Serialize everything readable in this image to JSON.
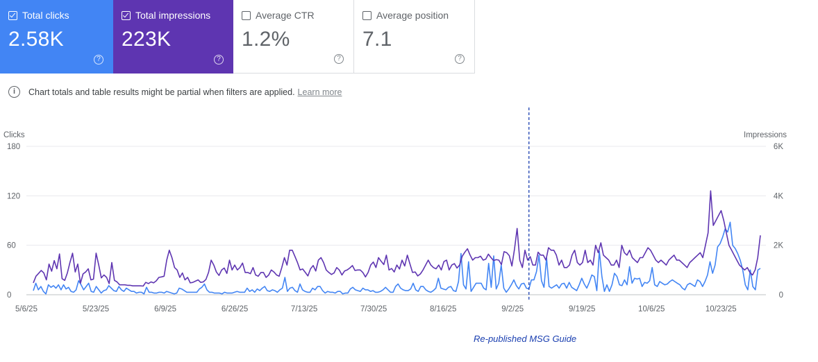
{
  "cards": [
    {
      "label": "Total clicks",
      "value": "2.58K",
      "checked": true
    },
    {
      "label": "Total impressions",
      "value": "223K",
      "checked": true
    },
    {
      "label": "Average CTR",
      "value": "1.2%",
      "checked": false
    },
    {
      "label": "Average position",
      "value": "7.1",
      "checked": false
    }
  ],
  "notice": {
    "text": "Chart totals and table results might be partial when filters are applied.",
    "link": "Learn more"
  },
  "help_glyph": "?",
  "info_glyph": "i",
  "footer": "Re-published MSG Guide",
  "colors": {
    "clicks": "#4285f4",
    "impressions": "#5e35b1",
    "annotation": "#1a3fb0"
  },
  "chart_data": {
    "type": "line",
    "ylabel_left": "Clicks",
    "ylabel_right": "Impressions",
    "ylim_left": [
      0,
      180
    ],
    "ylim_right": [
      0,
      6000
    ],
    "yticks_left": [
      "0",
      "60",
      "120",
      "180"
    ],
    "yticks_right": [
      "0",
      "2K",
      "4K",
      "6K"
    ],
    "x_start": "5/6/25",
    "x_end": "11/3/25",
    "xticks": [
      "5/6/25",
      "5/23/25",
      "6/9/25",
      "6/26/25",
      "7/13/25",
      "7/30/25",
      "8/16/25",
      "9/2/25",
      "9/19/25",
      "10/6/25",
      "10/23/25"
    ],
    "annotation_date": "9/6/25",
    "grid": true,
    "series": [
      {
        "name": "Clicks",
        "axis": "left",
        "values": [
          5,
          14,
          6,
          10,
          4,
          1,
          12,
          9,
          11,
          8,
          12,
          6,
          12,
          7,
          9,
          4,
          3,
          6,
          17,
          12,
          6,
          10,
          14,
          4,
          3,
          10,
          6,
          2,
          5,
          6,
          11,
          8,
          5,
          4,
          10,
          6,
          4,
          8,
          6,
          4,
          4,
          2,
          3,
          3,
          1,
          9,
          3,
          3,
          2,
          2,
          3,
          3,
          2,
          4,
          3,
          2,
          1,
          2,
          8,
          7,
          5,
          3,
          3,
          3,
          3,
          3,
          7,
          9,
          13,
          6,
          3,
          3,
          2,
          2,
          2,
          1,
          3,
          2,
          2,
          2,
          3,
          4,
          3,
          3,
          3,
          8,
          4,
          6,
          3,
          7,
          5,
          8,
          10,
          5,
          4,
          6,
          5,
          3,
          6,
          8,
          21,
          4,
          8,
          9,
          5,
          3,
          13,
          6,
          4,
          3,
          3,
          8,
          6,
          10,
          10,
          5,
          2,
          4,
          3,
          3,
          2,
          4,
          4,
          1,
          2,
          2,
          7,
          9,
          6,
          5,
          4,
          8,
          6,
          6,
          4,
          5,
          3,
          3,
          4,
          6,
          9,
          6,
          3,
          3,
          10,
          13,
          8,
          6,
          5,
          5,
          7,
          14,
          6,
          4,
          10,
          10,
          6,
          4,
          3,
          5,
          8,
          20,
          8,
          7,
          6,
          9,
          10,
          5,
          4,
          16,
          50,
          12,
          7,
          40,
          4,
          9,
          14,
          14,
          14,
          8,
          6,
          38,
          9,
          47,
          7,
          14,
          36,
          8,
          3,
          7,
          12,
          18,
          11,
          7,
          13,
          14,
          8,
          7,
          18,
          18,
          28,
          48,
          17,
          9,
          45,
          10,
          8,
          10,
          12,
          8,
          13,
          14,
          8,
          15,
          9,
          7,
          5,
          12,
          20,
          13,
          8,
          15,
          24,
          22,
          5,
          53,
          22,
          4,
          12,
          4,
          12,
          26,
          22,
          12,
          11,
          18,
          12,
          34,
          14,
          20,
          19,
          20,
          10,
          15,
          14,
          17,
          33,
          12,
          10,
          16,
          14,
          12,
          13,
          16,
          18,
          16,
          14,
          12,
          8,
          6,
          12,
          14,
          12,
          10,
          18,
          16,
          10,
          16,
          24,
          40,
          26,
          36,
          58,
          62,
          70,
          80,
          76,
          88,
          60,
          56,
          50,
          42,
          30,
          12,
          6,
          30,
          10,
          6,
          30,
          32
        ]
      },
      {
        "name": "Total impressions",
        "axis": "right",
        "values": [
          480,
          750,
          860,
          980,
          880,
          600,
          1240,
          950,
          1380,
          1050,
          1650,
          650,
          580,
          880,
          1300,
          1680,
          920,
          1240,
          460,
          840,
          920,
          1050,
          600,
          630,
          1680,
          1200,
          680,
          800,
          700,
          450,
          1300,
          580,
          520,
          400,
          400,
          400,
          380,
          380,
          360,
          360,
          360,
          360,
          350,
          500,
          450,
          520,
          480,
          560,
          700,
          720,
          750,
          1400,
          1800,
          1500,
          1100,
          1000,
          700,
          880,
          600,
          700,
          480,
          500,
          550,
          600,
          500,
          520,
          620,
          900,
          1400,
          1200,
          920,
          780,
          1000,
          1080,
          860,
          1400,
          1000,
          1200,
          1000,
          1100,
          1280,
          900,
          900,
          850,
          1100,
          800,
          750,
          900,
          900,
          700,
          800,
          1000,
          920,
          800,
          750,
          1100,
          1500,
          1200,
          1800,
          1800,
          1560,
          1300,
          1000,
          1040,
          900,
          760,
          1050,
          1180,
          960,
          1400,
          1500,
          1300,
          1000,
          900,
          820,
          880,
          1100,
          1000,
          800,
          960,
          1000,
          1080,
          1180,
          980,
          1000,
          1000,
          900,
          720,
          900,
          1200,
          1320,
          1100,
          1500,
          1350,
          1220,
          1600,
          1000,
          1060,
          920,
          1200,
          1040,
          1400,
          1160,
          1600,
          1250,
          900,
          920,
          760,
          840,
          1000,
          1200,
          1400,
          1200,
          1100,
          1050,
          1200,
          1000,
          1340,
          1400,
          1000,
          1200,
          1260,
          1080,
          1200,
          1560,
          1720,
          1860,
          1600,
          1400,
          1500,
          1500,
          1560,
          1400,
          1440,
          1640,
          1500,
          1380,
          1420,
          1400,
          1220,
          1740,
          1700,
          1580,
          1160,
          1860,
          2680,
          1400,
          1100,
          1800,
          1400,
          1540,
          1200,
          1200,
          1720,
          1600,
          1600,
          1400,
          1900,
          1800,
          1800,
          1600,
          1200,
          1400,
          1100,
          1100,
          1200,
          1600,
          1800,
          1300,
          1200,
          1300,
          1800,
          1300,
          1400,
          1200,
          2000,
          1700,
          2100,
          1600,
          1500,
          1400,
          1200,
          1200,
          1400,
          1100,
          2000,
          1700,
          1600,
          1800,
          1500,
          1400,
          1300,
          1500,
          1500,
          1700,
          1900,
          1800,
          1600,
          1400,
          1300,
          1400,
          1300,
          1200,
          1400,
          1500,
          1600,
          1400,
          1400,
          1300,
          1200,
          1100,
          1300,
          1400,
          1500,
          1600,
          1700,
          1500,
          2000,
          2500,
          4200,
          2800,
          3000,
          3200,
          3400,
          3000,
          2500,
          2000,
          1800,
          1600,
          1400,
          1200,
          1100,
          1000,
          1100,
          900,
          800,
          1000,
          1500,
          2400
        ]
      }
    ]
  }
}
